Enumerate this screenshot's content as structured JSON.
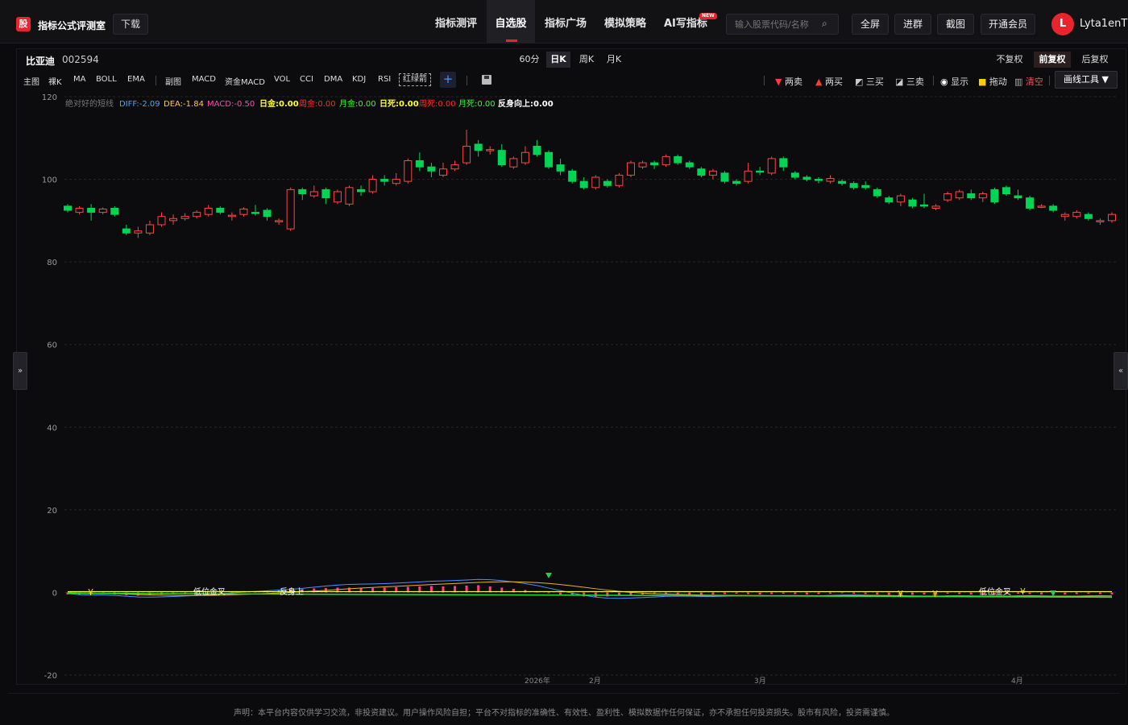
{
  "app": {
    "logo_char": "股",
    "title": "指标公式评测室",
    "download": "下载"
  },
  "nav": [
    {
      "label": "指标测评",
      "active": false
    },
    {
      "label": "自选股",
      "active": true
    },
    {
      "label": "指标广场",
      "active": false
    },
    {
      "label": "模拟策略",
      "active": false
    },
    {
      "label": "AI写指标",
      "active": false,
      "badge": "NEW"
    }
  ],
  "search": {
    "placeholder": "输入股票代码/名称",
    "icon": "search-icon"
  },
  "top_buttons": [
    "全屏",
    "进群",
    "截图",
    "开通会员"
  ],
  "user": {
    "avatar": "L",
    "name": "Lyta1enT"
  },
  "stock": {
    "name": "比亚迪",
    "code": "002594"
  },
  "periods": [
    {
      "label": "60分",
      "active": false
    },
    {
      "label": "日K",
      "active": true
    },
    {
      "label": "周K",
      "active": false
    },
    {
      "label": "月K",
      "active": false
    }
  ],
  "adjust": [
    {
      "label": "不复权",
      "active": false
    },
    {
      "label": "前复权",
      "active": true
    },
    {
      "label": "后复权",
      "active": false
    }
  ],
  "indicators": [
    "主图",
    "裸K",
    "MA",
    "BOLL",
    "EMA",
    "副图",
    "MACD",
    "资金MACD",
    "VOL",
    "CCI",
    "DMA",
    "KDJ",
    "RSI",
    "红绿箭"
  ],
  "tools": {
    "sell2": "两卖",
    "buy2": "两买",
    "buy3": "三买",
    "sell3": "三卖",
    "show": "显示",
    "drag": "拖动",
    "clear": "清空",
    "draw": "画线工具 ▼"
  },
  "side": {
    "left": "»",
    "right": "«"
  },
  "legend": {
    "name": "绝对好的短线",
    "diff": "DIFF:-2.09",
    "dea": "DEA:-1.84",
    "macd": "MACD:-0.50",
    "rijin": "日金:0.00",
    "zhoujin": "周金:0.00",
    "yuejin": "月金:0.00",
    "risi": "日死:0.00",
    "zhousi": "周死:0.00",
    "yuesi": "月死:0.00",
    "fanshen": "反身向上:0.00"
  },
  "chart_data": {
    "type": "candlestick",
    "ylim": [
      -20,
      120
    ],
    "y_ticks": [
      120,
      100,
      80,
      60,
      40,
      20,
      0,
      -20
    ],
    "x_tick_labels": [
      "2026年",
      "2月",
      "3月",
      "4月"
    ],
    "annotations": [
      "低位金叉",
      "反身上",
      "低位金叉",
      "¥"
    ],
    "candles": [
      [
        93.5,
        92.5,
        94.0,
        92.0
      ],
      [
        92.0,
        93.0,
        93.5,
        91.5
      ],
      [
        93.0,
        92.0,
        94.0,
        90.0
      ],
      [
        92.0,
        92.8,
        93.2,
        91.5
      ],
      [
        93.0,
        91.5,
        93.5,
        91.0
      ],
      [
        88.0,
        87.0,
        89.0,
        86.5
      ],
      [
        87.0,
        87.5,
        88.5,
        85.8
      ],
      [
        87.0,
        89.0,
        90.0,
        86.5
      ],
      [
        89.0,
        91.0,
        92.0,
        88.5
      ],
      [
        90.0,
        90.5,
        91.5,
        89.0
      ],
      [
        90.5,
        91.0,
        91.8,
        90.0
      ],
      [
        91.0,
        92.0,
        92.5,
        90.5
      ],
      [
        91.5,
        93.0,
        93.8,
        91.0
      ],
      [
        93.0,
        92.0,
        93.5,
        91.5
      ],
      [
        91.0,
        91.3,
        92.0,
        90.0
      ],
      [
        91.5,
        92.8,
        93.2,
        91.0
      ],
      [
        92.0,
        91.8,
        93.8,
        91.2
      ],
      [
        92.5,
        91.0,
        93.0,
        90.0
      ],
      [
        90.0,
        90.0,
        90.5,
        89.0
      ],
      [
        88.0,
        97.5,
        98.0,
        87.5
      ],
      [
        97.5,
        96.5,
        98.0,
        95.0
      ],
      [
        96.0,
        97.0,
        98.5,
        95.5
      ],
      [
        97.5,
        95.5,
        98.0,
        94.0
      ],
      [
        94.5,
        97.0,
        97.5,
        94.0
      ],
      [
        94.0,
        98.0,
        98.5,
        93.5
      ],
      [
        97.5,
        97.0,
        98.5,
        96.0
      ],
      [
        97.0,
        100.0,
        101.0,
        96.5
      ],
      [
        100.0,
        99.5,
        101.0,
        98.5
      ],
      [
        99.0,
        100.0,
        101.5,
        98.5
      ],
      [
        99.5,
        104.5,
        105.0,
        99.0
      ],
      [
        104.5,
        103.0,
        106.5,
        102.0
      ],
      [
        103.0,
        102.0,
        104.0,
        100.5
      ],
      [
        101.0,
        102.5,
        104.0,
        100.5
      ],
      [
        102.5,
        103.5,
        104.5,
        102.0
      ],
      [
        104.0,
        108.0,
        112.0,
        103.5
      ],
      [
        108.5,
        107.0,
        109.5,
        105.5
      ],
      [
        107.0,
        107.2,
        108.0,
        106.0
      ],
      [
        107.0,
        103.5,
        108.5,
        103.0
      ],
      [
        103.0,
        105.0,
        105.5,
        102.5
      ],
      [
        104.0,
        106.5,
        108.0,
        103.5
      ],
      [
        108.0,
        106.0,
        109.5,
        105.5
      ],
      [
        106.5,
        103.0,
        107.0,
        102.5
      ],
      [
        103.5,
        102.0,
        105.0,
        101.0
      ],
      [
        102.0,
        99.5,
        102.5,
        99.0
      ],
      [
        99.5,
        98.0,
        100.5,
        97.5
      ],
      [
        98.0,
        100.5,
        101.0,
        97.5
      ],
      [
        99.5,
        98.5,
        100.0,
        98.0
      ],
      [
        98.5,
        101.0,
        101.5,
        98.0
      ],
      [
        101.0,
        104.0,
        104.5,
        100.5
      ],
      [
        103.0,
        104.0,
        104.5,
        102.5
      ],
      [
        104.0,
        103.5,
        104.5,
        102.5
      ],
      [
        103.5,
        105.5,
        106.0,
        103.0
      ],
      [
        105.5,
        104.0,
        106.0,
        103.5
      ],
      [
        104.0,
        103.0,
        104.5,
        102.5
      ],
      [
        102.5,
        101.0,
        103.0,
        100.5
      ],
      [
        101.0,
        102.0,
        102.5,
        100.0
      ],
      [
        101.5,
        99.5,
        102.0,
        99.0
      ],
      [
        99.5,
        99.0,
        100.0,
        98.5
      ],
      [
        99.5,
        102.0,
        104.0,
        99.0
      ],
      [
        102.0,
        101.8,
        103.0,
        101.0
      ],
      [
        101.5,
        105.0,
        105.5,
        101.0
      ],
      [
        105.0,
        103.0,
        105.5,
        102.0
      ],
      [
        101.5,
        100.5,
        102.0,
        100.0
      ],
      [
        100.5,
        100.0,
        101.0,
        99.5
      ],
      [
        100.0,
        99.8,
        100.5,
        99.0
      ],
      [
        99.5,
        100.2,
        101.0,
        99.0
      ],
      [
        99.5,
        99.0,
        100.0,
        98.5
      ],
      [
        99.0,
        98.0,
        99.5,
        97.5
      ],
      [
        98.5,
        98.0,
        99.5,
        97.5
      ],
      [
        97.5,
        96.0,
        98.0,
        95.5
      ],
      [
        95.5,
        94.5,
        96.0,
        94.0
      ],
      [
        94.5,
        96.0,
        96.5,
        93.5
      ],
      [
        95.0,
        93.5,
        95.5,
        93.0
      ],
      [
        93.8,
        93.5,
        96.5,
        93.0
      ],
      [
        93.0,
        93.5,
        94.0,
        92.5
      ],
      [
        95.0,
        96.5,
        97.0,
        94.5
      ],
      [
        95.5,
        97.0,
        97.5,
        95.0
      ],
      [
        96.5,
        95.5,
        97.5,
        95.0
      ],
      [
        95.5,
        96.5,
        97.0,
        94.5
      ],
      [
        97.5,
        94.5,
        98.0,
        94.0
      ],
      [
        98.0,
        96.5,
        98.5,
        96.0
      ],
      [
        96.0,
        95.5,
        97.5,
        95.0
      ],
      [
        95.5,
        93.0,
        96.0,
        92.5
      ],
      [
        93.5,
        93.5,
        94.0,
        93.0
      ],
      [
        93.5,
        92.5,
        94.0,
        92.0
      ],
      [
        91.0,
        91.5,
        92.0,
        90.0
      ],
      [
        91.0,
        92.0,
        92.5,
        90.5
      ],
      [
        91.5,
        90.5,
        92.0,
        90.0
      ],
      [
        90.0,
        90.0,
        90.5,
        89.0
      ],
      [
        90.0,
        91.5,
        92.0,
        89.5
      ]
    ],
    "osc_bars": [
      -0.5,
      -0.6,
      -0.4,
      -0.3,
      -0.5,
      -0.7,
      -0.8,
      -0.6,
      -0.5,
      -0.4,
      -0.3,
      -0.2,
      -0.1,
      0.1,
      0.2,
      0.3,
      0.3,
      0.4,
      0.5,
      0.6,
      0.8,
      1.0,
      1.1,
      1.2,
      1.2,
      1.1,
      1.1,
      1.2,
      1.3,
      1.4,
      1.5,
      1.6,
      1.5,
      1.6,
      1.7,
      1.8,
      1.5,
      1.2,
      0.9,
      0.6,
      0.3,
      -0.2,
      -0.5,
      -0.8,
      -1.0,
      -1.1,
      -1.0,
      -0.8,
      -0.6,
      -0.5,
      -0.4,
      -0.3,
      -0.4,
      -0.5,
      -0.6,
      -0.5,
      -0.4,
      -0.3,
      -0.4,
      -0.5,
      -0.4,
      -0.3,
      -0.4,
      -0.5,
      -0.4,
      -0.3,
      -0.2,
      -0.3,
      -0.4,
      -0.5,
      -0.6,
      -0.7,
      -0.6,
      -0.5,
      -0.4,
      -0.3,
      -0.4,
      -0.5,
      -0.6,
      -0.5,
      -0.4,
      -0.3,
      -0.4,
      -0.5,
      -0.6,
      -0.5,
      -0.4,
      -0.3,
      -0.4,
      -0.5
    ]
  },
  "disclaimer": "声明：本平台内容仅供学习交流，非投资建议。用户操作风险自担；平台不对指标的准确性、有效性、盈利性、模拟数据作任何保证，亦不承担任何投资损失。股市有风险，投资需谨慎。"
}
